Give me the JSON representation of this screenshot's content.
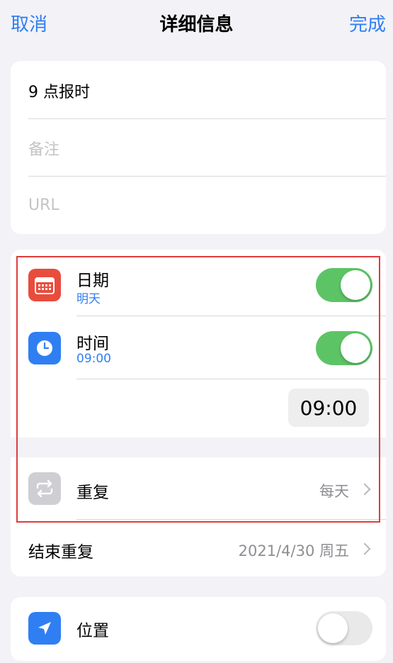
{
  "nav": {
    "cancel": "取消",
    "title": "详细信息",
    "done": "完成"
  },
  "fields": {
    "title": "9 点报时",
    "notes_placeholder": "备注",
    "url_placeholder": "URL"
  },
  "date": {
    "label": "日期",
    "value": "明天",
    "enabled": true
  },
  "time": {
    "label": "时间",
    "value": "09:00",
    "enabled": true,
    "picker_value": "09:00"
  },
  "repeat": {
    "label": "重复",
    "value": "每天"
  },
  "end_repeat": {
    "label": "结束重复",
    "value": "2021/4/30 周五"
  },
  "location": {
    "label": "位置",
    "enabled": false
  },
  "colors": {
    "accent": "#2f7ff3",
    "toggle_on": "#5dc466",
    "date_icon": "#e84c3d",
    "time_icon": "#2f7ff3",
    "repeat_icon": "#cfcfd3",
    "location_icon": "#2f7ff3",
    "highlight": "#e03c3c"
  }
}
